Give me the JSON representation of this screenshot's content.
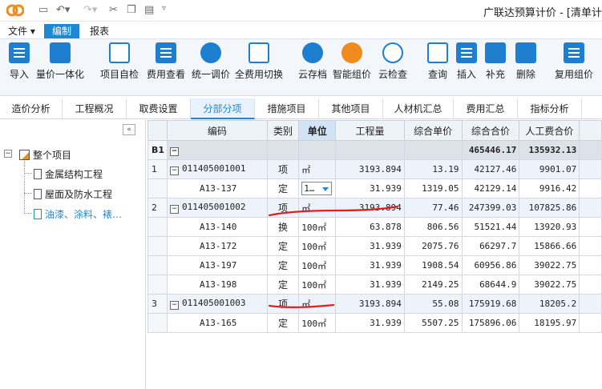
{
  "app": {
    "title": "广联达预算计价 - [清单计"
  },
  "menu": [
    "文件",
    "编制",
    "报表"
  ],
  "ribbon": [
    {
      "label": "导入",
      "icon": "import-icon"
    },
    {
      "label": "量价一体化",
      "icon": "integration-icon"
    },
    {
      "label": "项目自检",
      "icon": "self-check-icon"
    },
    {
      "label": "费用查看",
      "icon": "fee-view-icon"
    },
    {
      "label": "统一调价",
      "icon": "price-adjust-icon"
    },
    {
      "label": "全费用切换",
      "icon": "full-fee-switch-icon"
    },
    {
      "label": "云存档",
      "icon": "cloud-archive-icon"
    },
    {
      "label": "智能组价",
      "icon": "smart-pricing-icon"
    },
    {
      "label": "云检查",
      "icon": "cloud-check-icon"
    },
    {
      "label": "查询",
      "icon": "query-icon"
    },
    {
      "label": "插入",
      "icon": "insert-icon"
    },
    {
      "label": "补充",
      "icon": "supplement-icon"
    },
    {
      "label": "删除",
      "icon": "delete-icon"
    },
    {
      "label": "复用组价",
      "icon": "reuse-pricing-icon"
    }
  ],
  "tabs": [
    "造价分析",
    "工程概况",
    "取费设置",
    "分部分项",
    "措施项目",
    "其他项目",
    "人材机汇总",
    "费用汇总",
    "指标分析"
  ],
  "tree": {
    "root": "整个项目",
    "children": [
      "金属结构工程",
      "屋面及防水工程",
      "油漆、涂料、裱…"
    ]
  },
  "grid": {
    "headers": [
      "编码",
      "类别",
      "单位",
      "工程量",
      "综合单价",
      "综合合价",
      "人工费合价"
    ],
    "b1": {
      "label": "B1",
      "total": "465446.17",
      "labor": "135932.13"
    },
    "rows": [
      {
        "no": "1",
        "code": "011405001001",
        "type": "项",
        "unit": "㎡",
        "qty": "3193.894",
        "price": "13.19",
        "total": "42127.46",
        "labor": "9901.07"
      },
      {
        "no": "",
        "code": "A13-137",
        "type": "定",
        "unit": "1…",
        "qty": "31.939",
        "price": "1319.05",
        "total": "42129.14",
        "labor": "9916.42"
      },
      {
        "no": "2",
        "code": "011405001002",
        "type": "项",
        "unit": "㎡",
        "qty": "3193.894",
        "price": "77.46",
        "total": "247399.03",
        "labor": "107825.86"
      },
      {
        "no": "",
        "code": "A13-140",
        "type": "换",
        "unit": "100㎡",
        "qty": "63.878",
        "price": "806.56",
        "total": "51521.44",
        "labor": "13920.93"
      },
      {
        "no": "",
        "code": "A13-172",
        "type": "定",
        "unit": "100㎡",
        "qty": "31.939",
        "price": "2075.76",
        "total": "66297.7",
        "labor": "15866.66"
      },
      {
        "no": "",
        "code": "A13-197",
        "type": "定",
        "unit": "100㎡",
        "qty": "31.939",
        "price": "1908.54",
        "total": "60956.86",
        "labor": "39022.75"
      },
      {
        "no": "",
        "code": "A13-198",
        "type": "定",
        "unit": "100㎡",
        "qty": "31.939",
        "price": "2149.25",
        "total": "68644.9",
        "labor": "39022.75"
      },
      {
        "no": "3",
        "code": "011405001003",
        "type": "项",
        "unit": "㎡",
        "qty": "3193.894",
        "price": "55.08",
        "total": "175919.68",
        "labor": "18205.2"
      },
      {
        "no": "",
        "code": "A13-165",
        "type": "定",
        "unit": "100㎡",
        "qty": "31.939",
        "price": "5507.25",
        "total": "175896.06",
        "labor": "18195.97"
      }
    ]
  },
  "colors": {
    "accent": "#1e88d2",
    "annotation": "#e02020"
  }
}
